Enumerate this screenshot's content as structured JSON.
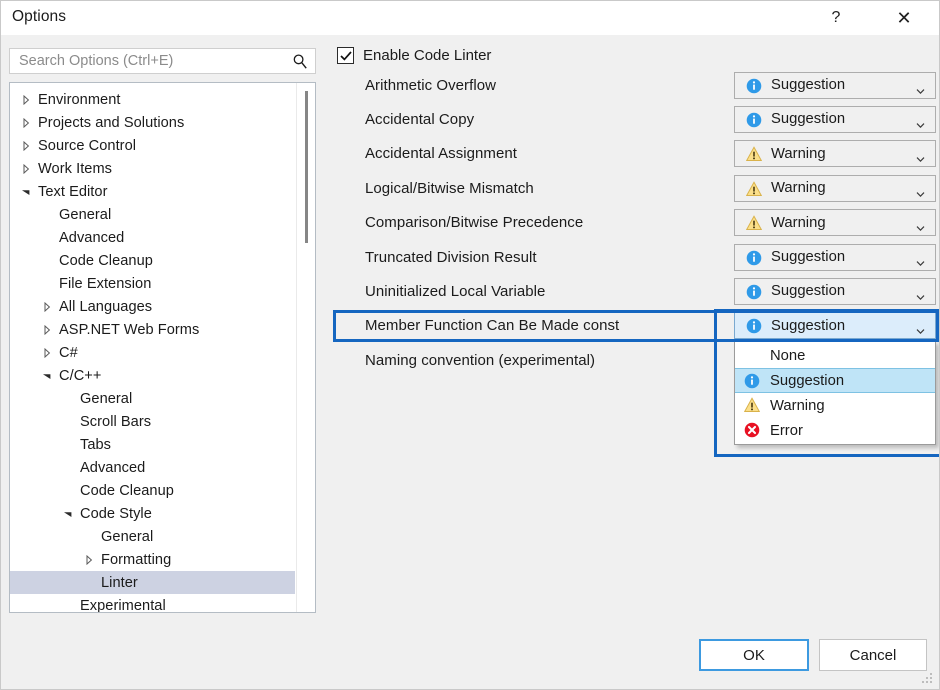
{
  "window": {
    "title": "Options",
    "help_label": "?",
    "close_label": "✕"
  },
  "search": {
    "placeholder": "Search Options (Ctrl+E)",
    "value": "",
    "icon": "search-icon"
  },
  "tree": {
    "items": [
      {
        "label": "Environment",
        "indent": 0,
        "twisty": "collapsed",
        "selected": false
      },
      {
        "label": "Projects and Solutions",
        "indent": 0,
        "twisty": "collapsed",
        "selected": false
      },
      {
        "label": "Source Control",
        "indent": 0,
        "twisty": "collapsed",
        "selected": false
      },
      {
        "label": "Work Items",
        "indent": 0,
        "twisty": "collapsed",
        "selected": false
      },
      {
        "label": "Text Editor",
        "indent": 0,
        "twisty": "expanded",
        "selected": false
      },
      {
        "label": "General",
        "indent": 1,
        "twisty": "none",
        "selected": false
      },
      {
        "label": "Advanced",
        "indent": 1,
        "twisty": "none",
        "selected": false
      },
      {
        "label": "Code Cleanup",
        "indent": 1,
        "twisty": "none",
        "selected": false
      },
      {
        "label": "File Extension",
        "indent": 1,
        "twisty": "none",
        "selected": false
      },
      {
        "label": "All Languages",
        "indent": 1,
        "twisty": "collapsed",
        "selected": false
      },
      {
        "label": "ASP.NET Web Forms",
        "indent": 1,
        "twisty": "collapsed",
        "selected": false
      },
      {
        "label": "C#",
        "indent": 1,
        "twisty": "collapsed",
        "selected": false
      },
      {
        "label": "C/C++",
        "indent": 1,
        "twisty": "expanded",
        "selected": false
      },
      {
        "label": "General",
        "indent": 2,
        "twisty": "none",
        "selected": false
      },
      {
        "label": "Scroll Bars",
        "indent": 2,
        "twisty": "none",
        "selected": false
      },
      {
        "label": "Tabs",
        "indent": 2,
        "twisty": "none",
        "selected": false
      },
      {
        "label": "Advanced",
        "indent": 2,
        "twisty": "none",
        "selected": false
      },
      {
        "label": "Code Cleanup",
        "indent": 2,
        "twisty": "none",
        "selected": false
      },
      {
        "label": "Code Style",
        "indent": 2,
        "twisty": "expanded",
        "selected": false
      },
      {
        "label": "General",
        "indent": 3,
        "twisty": "none",
        "selected": false
      },
      {
        "label": "Formatting",
        "indent": 3,
        "twisty": "collapsed",
        "selected": false
      },
      {
        "label": "Linter",
        "indent": 3,
        "twisty": "none",
        "selected": true
      },
      {
        "label": "Experimental",
        "indent": 2,
        "twisty": "none",
        "selected": false
      }
    ]
  },
  "options_pane": {
    "enable_linter": {
      "label": "Enable Code Linter",
      "checked": true
    },
    "rules": [
      {
        "name": "Arithmetic Overflow",
        "severity": "Suggestion",
        "icon": "info-icon"
      },
      {
        "name": "Accidental Copy",
        "severity": "Suggestion",
        "icon": "info-icon"
      },
      {
        "name": "Accidental Assignment",
        "severity": "Warning",
        "icon": "warning-icon"
      },
      {
        "name": "Logical/Bitwise Mismatch",
        "severity": "Warning",
        "icon": "warning-icon"
      },
      {
        "name": "Comparison/Bitwise Precedence",
        "severity": "Warning",
        "icon": "warning-icon"
      },
      {
        "name": "Truncated Division Result",
        "severity": "Suggestion",
        "icon": "info-icon"
      },
      {
        "name": "Uninitialized Local Variable",
        "severity": "Suggestion",
        "icon": "info-icon"
      },
      {
        "name": "Member Function Can Be Made const",
        "severity": "Suggestion",
        "icon": "info-icon",
        "highlighted": true,
        "dropdown_open": true
      },
      {
        "name": "Naming convention (experimental)",
        "severity": "",
        "icon": "none"
      }
    ],
    "dropdown": {
      "options": [
        {
          "label": "None",
          "icon": "none",
          "selected": false
        },
        {
          "label": "Suggestion",
          "icon": "info-icon",
          "selected": true
        },
        {
          "label": "Warning",
          "icon": "warning-icon",
          "selected": false
        },
        {
          "label": "Error",
          "icon": "error-icon",
          "selected": false
        }
      ]
    }
  },
  "footer": {
    "ok_label": "OK",
    "cancel_label": "Cancel"
  },
  "colors": {
    "accent_blue": "#1566c0",
    "info_blue": "#2f9ae8",
    "warning_yellow": "#fbdf8a",
    "error_red": "#e81123",
    "selection": "#cdd2e2",
    "dialog_bg": "#f0f0f0"
  }
}
